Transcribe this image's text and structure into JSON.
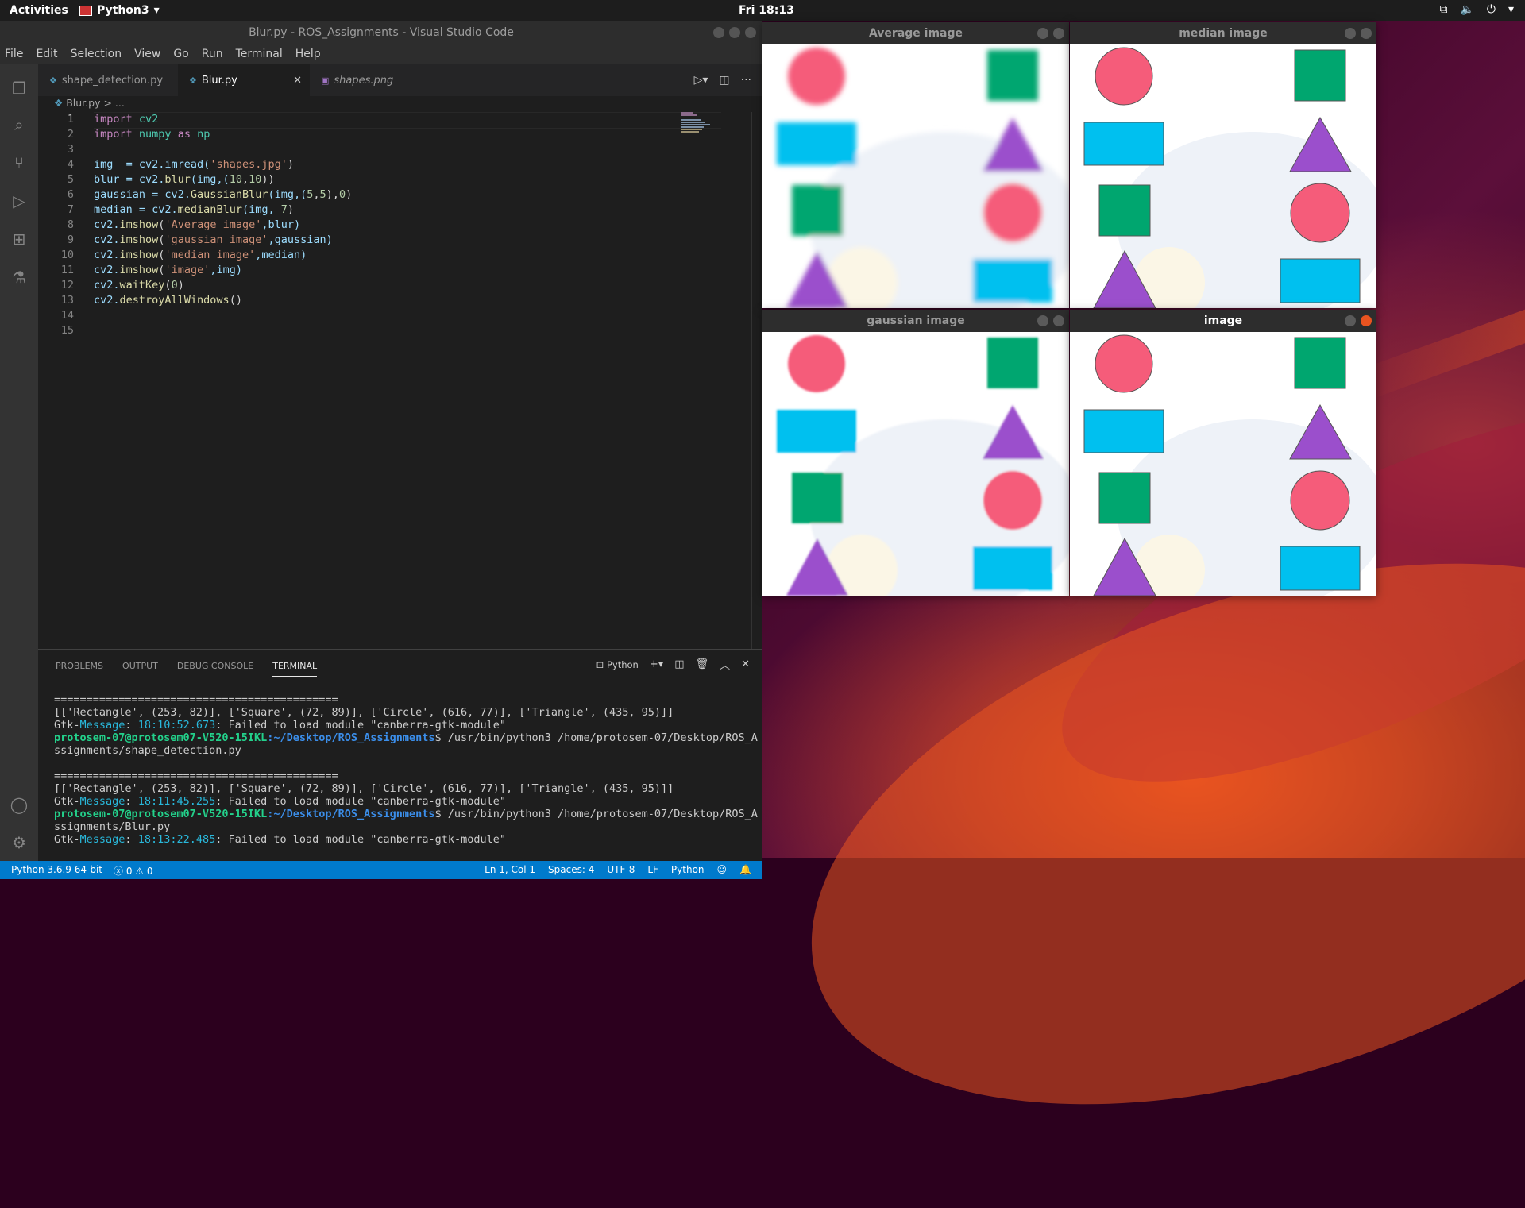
{
  "topbar": {
    "activities": "Activities",
    "app_name": "Python3",
    "clock": "Fri 18:13"
  },
  "vscode": {
    "title": "Blur.py - ROS_Assignments - Visual Studio Code",
    "menu": [
      "File",
      "Edit",
      "Selection",
      "View",
      "Go",
      "Run",
      "Terminal",
      "Help"
    ],
    "tabs": [
      {
        "label": "shape_detection.py",
        "active": false
      },
      {
        "label": "Blur.py",
        "active": true
      },
      {
        "label": "shapes.png",
        "active": false
      }
    ],
    "breadcrumb": "Blur.py > ...",
    "line_numbers": [
      "1",
      "2",
      "3",
      "4",
      "5",
      "6",
      "7",
      "8",
      "9",
      "10",
      "11",
      "12",
      "13",
      "14",
      "15"
    ],
    "code": {
      "l1a": "import",
      "l1b": " cv2",
      "l2a": "import",
      "l2b": " numpy",
      "l2c": " as",
      "l2d": " np",
      "l4": "img  = cv2.imread(",
      "l4s": "'shapes.jpg'",
      "l4e": ")",
      "l5a": "blur = cv2.",
      "l5b": "blur",
      "l5c": "(img,(",
      "l5d": "10",
      "l5e": ",",
      "l5f": "10",
      "l5g": "))",
      "l6a": "gaussian = cv2.",
      "l6b": "GaussianBlur",
      "l6c": "(img,(",
      "l6d": "5",
      "l6e": ",",
      "l6f": "5",
      "l6g": "),",
      "l6h": "0",
      "l6i": ")",
      "l7a": "median = cv2.",
      "l7b": "medianBlur",
      "l7c": "(img, ",
      "l7d": "7",
      "l7e": ")",
      "l8a": "cv2.",
      "l8b": "imshow",
      "l8c": "(",
      "l8d": "'Average image'",
      "l8e": ",blur)",
      "l9a": "cv2.",
      "l9b": "imshow",
      "l9c": "(",
      "l9d": "'gaussian image'",
      "l9e": ",gaussian)",
      "l10a": "cv2.",
      "l10b": "imshow",
      "l10c": "(",
      "l10d": "'median image'",
      "l10e": ",median)",
      "l11a": "cv2.",
      "l11b": "imshow",
      "l11c": "(",
      "l11d": "'image'",
      "l11e": ",img)",
      "l12a": "cv2.",
      "l12b": "waitKey",
      "l12c": "(",
      "l12d": "0",
      "l12e": ")",
      "l13a": "cv2.",
      "l13b": "destroyAllWindows",
      "l13c": "()"
    },
    "panel_tabs": [
      "PROBLEMS",
      "OUTPUT",
      "DEBUG CONSOLE",
      "TERMINAL"
    ],
    "terminal_shell": "Python",
    "terminal": {
      "sep": "============================================",
      "result": "[['Rectangle', (253, 82)], ['Square', (72, 89)], ['Circle', (616, 77)], ['Triangle', (435, 95)]]",
      "gtk_a": "Gtk-",
      "gtk_b": "Message",
      "gtk_colon": ": ",
      "ts1": "18:10:52.673",
      "ts2": "18:11:45.255",
      "ts3": "18:13:22.485",
      "gtk_msg": ": Failed to load module \"canberra-gtk-module\"",
      "prompt_user": "protosem-07@protosem07-V520-15IKL",
      "prompt_path": ":~/Desktop/ROS_Assignments",
      "cmd1": "$ /usr/bin/python3 /home/protosem-07/Desktop/ROS_A",
      "cmd1b": "ssignments/shape_detection.py",
      "cmd2": "$ /usr/bin/python3 /home/protosem-07/Desktop/ROS_A",
      "cmd2b": "ssignments/Blur.py"
    },
    "status": {
      "python": "Python 3.6.9 64-bit",
      "problems": "ⓧ 0 ⚠ 0",
      "position": "Ln 1, Col 1",
      "spaces": "Spaces: 4",
      "encoding": "UTF-8",
      "eol": "LF",
      "language": "Python"
    }
  },
  "image_windows": [
    {
      "title": "Average image",
      "blur": "heavy"
    },
    {
      "title": "median image",
      "blur": "none"
    },
    {
      "title": "gaussian image",
      "blur": "light"
    },
    {
      "title": "image",
      "blur": "none"
    }
  ],
  "colors": {
    "circle": "#f55c7a",
    "square": "#00a66f",
    "rectangle": "#00c0ef",
    "triangle": "#9b4fcc",
    "vscode_status": "#007acc",
    "ubuntu_orange": "#e95420"
  }
}
